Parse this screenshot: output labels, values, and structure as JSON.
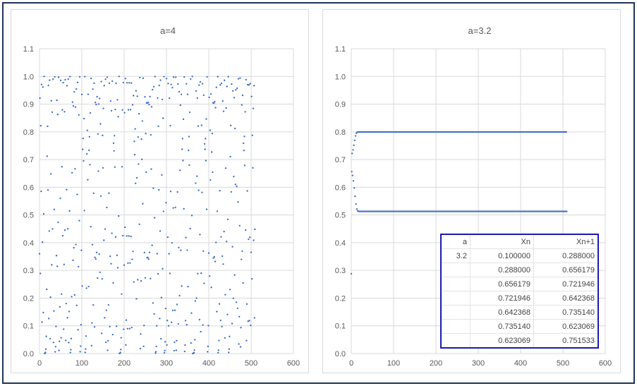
{
  "chart_data": [
    {
      "type": "scatter",
      "title": "a=4",
      "a": 4,
      "x0": 0.1,
      "points": 510,
      "series_rule": "X(n+1)=a*Xn*(1-Xn), plotted vs n",
      "xlim": [
        0,
        600
      ],
      "ylim": [
        0,
        1.1
      ],
      "xticks": [
        "0",
        "100",
        "200",
        "300",
        "400",
        "500",
        "600"
      ],
      "yticks": [
        "0.0",
        "0.1",
        "0.2",
        "0.3",
        "0.4",
        "0.5",
        "0.6",
        "0.7",
        "0.8",
        "0.9",
        "1.0",
        "1.1"
      ],
      "grid": true,
      "color": "#4472c4"
    },
    {
      "type": "scatter",
      "title": "a=3.2",
      "a": 3.2,
      "x0": 0.1,
      "points": 510,
      "series_rule": "X(n+1)=a*Xn*(1-Xn), plotted vs n",
      "xlim": [
        0,
        600
      ],
      "ylim": [
        0,
        1.1
      ],
      "xticks": [
        "0",
        "100",
        "200",
        "300",
        "400",
        "500",
        "600"
      ],
      "yticks": [
        "0.0",
        "0.1",
        "0.2",
        "0.3",
        "0.4",
        "0.5",
        "0.6",
        "0.7",
        "0.8",
        "0.9",
        "1.0",
        "1.1"
      ],
      "grid": true,
      "color": "#4472c4"
    }
  ],
  "table": {
    "headers": [
      "a",
      "Xn",
      "Xn+1"
    ],
    "rows": [
      [
        "3.2",
        "0.100000",
        "0.288000"
      ],
      [
        "",
        "0.288000",
        "0.656179"
      ],
      [
        "",
        "0.656179",
        "0.721946"
      ],
      [
        "",
        "0.721946",
        "0.642368"
      ],
      [
        "",
        "0.642368",
        "0.735140"
      ],
      [
        "",
        "0.735140",
        "0.623069"
      ],
      [
        "",
        "0.623069",
        "0.751533"
      ]
    ]
  }
}
